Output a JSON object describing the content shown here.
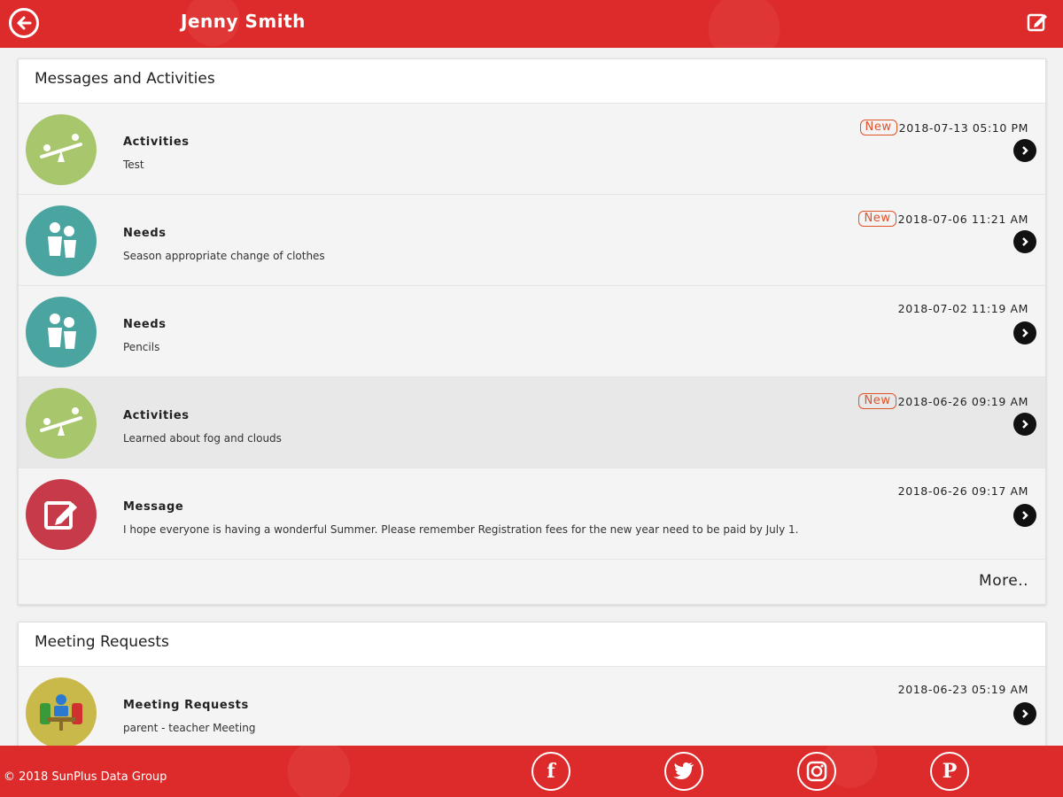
{
  "header": {
    "title": "Jenny Smith",
    "back_icon": "back-arrow-icon",
    "edit_icon": "edit-icon",
    "color": "#dd2a2a"
  },
  "messages": {
    "section_title": "Messages and Activities",
    "new_label": "New",
    "items": [
      {
        "type": "Activities",
        "text": "Test",
        "timestamp": "2018-07-13 05:10 PM",
        "is_new": true,
        "icon": "seesaw-icon",
        "icon_color": "#a8c66c"
      },
      {
        "type": "Needs",
        "text": "Season appropriate change of clothes",
        "timestamp": "2018-07-06 11:21 AM",
        "is_new": true,
        "icon": "kids-icon",
        "icon_color": "#4aa5a0"
      },
      {
        "type": "Needs",
        "text": "Pencils",
        "timestamp": "2018-07-02 11:19 AM",
        "is_new": false,
        "icon": "kids-icon",
        "icon_color": "#4aa5a0"
      },
      {
        "type": "Activities",
        "text": "Learned about fog and clouds",
        "timestamp": "2018-06-26 09:19 AM",
        "is_new": true,
        "icon": "seesaw-icon",
        "icon_color": "#a8c66c"
      },
      {
        "type": "Message",
        "text": "I hope everyone is having a wonderful Summer. Please remember Registration fees for the new year need to be paid by July 1.",
        "timestamp": "2018-06-26 09:17 AM",
        "is_new": false,
        "icon": "pencil-note-icon",
        "icon_color": "#c63a4a"
      }
    ],
    "more_label": "More.."
  },
  "meetings": {
    "section_title": "Meeting Requests",
    "items": [
      {
        "type": "Meeting Requests",
        "text": "parent - teacher Meeting",
        "timestamp": "2018-06-23 05:19 AM",
        "icon": "meeting-icon",
        "icon_color": "#c9b84a"
      }
    ]
  },
  "footer": {
    "copyright": "© 2018 SunPlus Data Group",
    "social": [
      {
        "name": "facebook-icon",
        "glyph": "f"
      },
      {
        "name": "twitter-icon",
        "glyph": "t"
      },
      {
        "name": "instagram-icon",
        "glyph": "◎"
      },
      {
        "name": "pinterest-icon",
        "glyph": "P"
      }
    ]
  }
}
